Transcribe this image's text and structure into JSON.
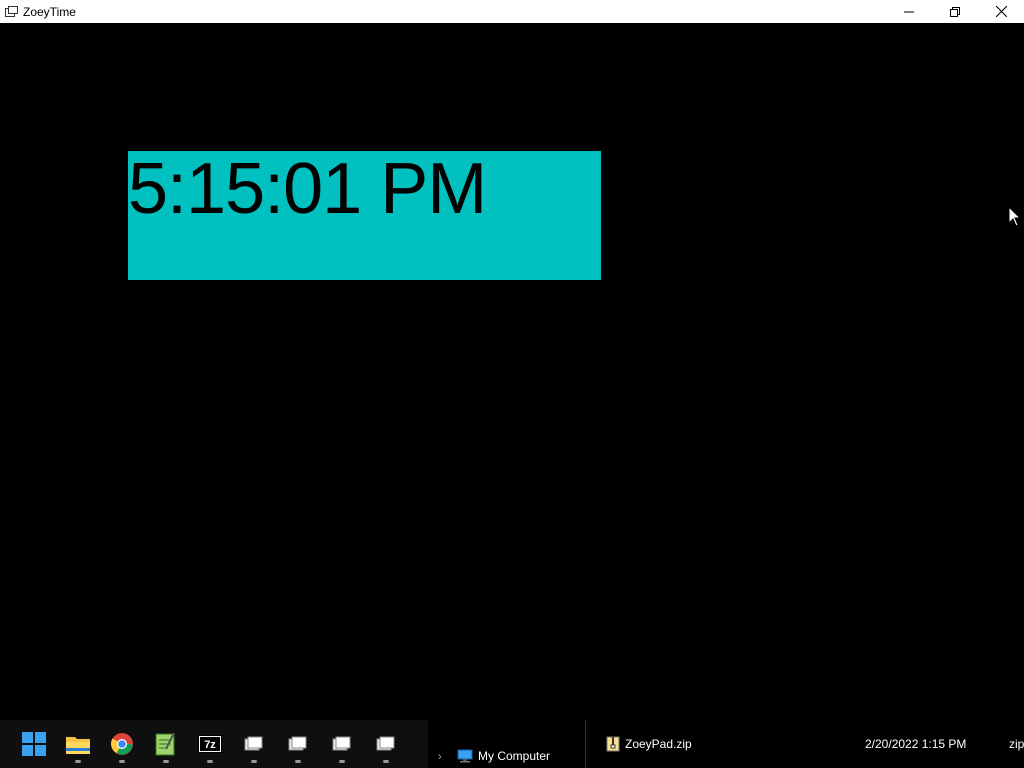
{
  "window": {
    "title": "ZoeyTime",
    "icon": "clock-app-icon",
    "controls": [
      "minimize-icon",
      "restore-icon",
      "close-icon"
    ]
  },
  "clock": {
    "time": "5:15:01 PM",
    "bg_color": "#00c0c0",
    "text_color": "#000000"
  },
  "taskbar": {
    "items": [
      {
        "name": "start-button",
        "icon": "windows-logo-icon"
      },
      {
        "name": "file-explorer",
        "icon": "folder-icon"
      },
      {
        "name": "chrome",
        "icon": "chrome-icon"
      },
      {
        "name": "notepad-plus",
        "icon": "notepad-icon"
      },
      {
        "name": "7zip",
        "icon": "7zip-icon",
        "label": "7z"
      },
      {
        "name": "window-1",
        "icon": "app-window-icon"
      },
      {
        "name": "window-2",
        "icon": "app-window-icon"
      },
      {
        "name": "window-3",
        "icon": "app-window-icon"
      },
      {
        "name": "window-4",
        "icon": "app-window-icon"
      }
    ]
  },
  "explorer": {
    "nav_item": "My Computer",
    "file_name": "ZoeyPad.zip",
    "file_date": "2/20/2022 1:15 PM",
    "file_type": "zip"
  }
}
